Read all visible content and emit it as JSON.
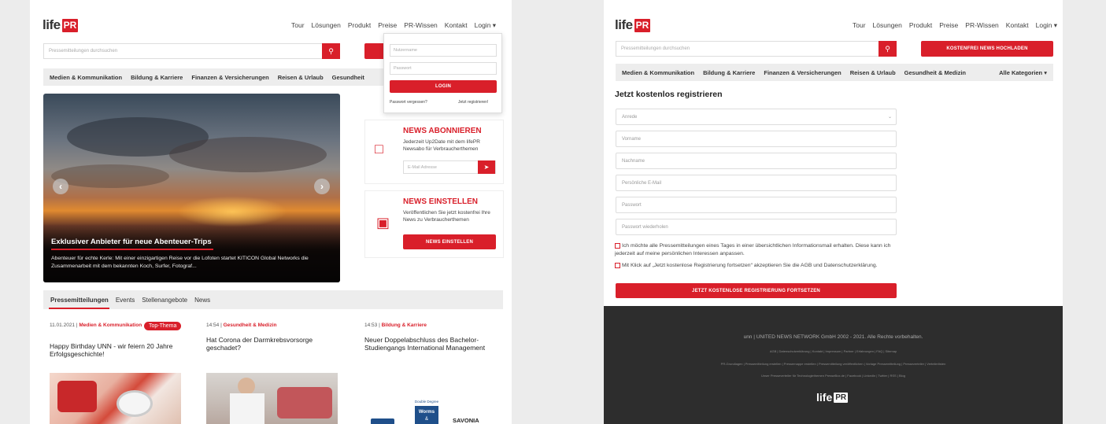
{
  "brand": {
    "logo_text": "life",
    "logo_badge": "PR",
    "accent": "#d91f2a"
  },
  "topnav": [
    "Tour",
    "Lösungen",
    "Produkt",
    "Preise",
    "PR-Wissen",
    "Kontakt",
    "Login ▾"
  ],
  "search": {
    "placeholder": "Pressemitteilungen durchsuchen"
  },
  "login_dropdown": {
    "user_placeholder": "Nutzername",
    "pass_placeholder": "Passwort",
    "login_btn": "LOGIN",
    "forgot": "Passwort vergessen?",
    "register": "Jetzt registrieren!"
  },
  "categories_left": [
    "Medien & Kommunikation",
    "Bildung & Karriere",
    "Finanzen & Versicherungen",
    "Reisen & Urlaub",
    "Gesundheit"
  ],
  "hero": {
    "title": "Exklusiver Anbieter für neue Abenteuer-Trips",
    "desc": "Abenteuer für echte Kerle: Mit einer einzigartigen Reise vor die Lofoten startet KITICON Global Networks die Zusammenarbeit mit dem bekannten Koch, Surfer, Fotograf..."
  },
  "sub_card": {
    "title": "NEWS ABONNIEREN",
    "text": "Jederzeit Up2Date mit dem lifePR Newsabo für Verbraucherthemen",
    "email_placeholder": "E-Mail Adresse"
  },
  "post_card": {
    "title": "NEWS EINSTELLEN",
    "text": "Veröffentlichen Sie jetzt kostenfrei Ihre News zu Verbraucherthemen",
    "btn": "NEWS EINSTELLEN"
  },
  "tabs": [
    "Pressemitteilungen",
    "Events",
    "Stellenangebote",
    "News"
  ],
  "news": [
    {
      "date": "11.01.2021 |",
      "cat": "Medien & Kommunikation",
      "tag": "Top-Thema",
      "headline": "Happy Birthday UNN - wir feiern 20 Jahre Erfolgsgeschichte!"
    },
    {
      "date": "14:54 |",
      "cat": "Gesundheit & Medizin",
      "tag": "",
      "headline": "Hat Corona der Darmkrebsvorsorge geschadet?"
    },
    {
      "date": "14:53 |",
      "cat": "Bildung & Karriere",
      "tag": "",
      "headline": "Neuer Doppelabschluss des Bachelor-Studiengangs International Management"
    }
  ],
  "news3_img": {
    "badge_top": "Double Degree",
    "badge_mid": "Worms",
    "badge_amp": "&",
    "partner": "SAVONIA"
  },
  "right": {
    "upload_btn": "KOSTENFREI NEWS HOCHLADEN",
    "categories": [
      "Medien & Kommunikation",
      "Bildung & Karriere",
      "Finanzen & Versicherungen",
      "Reisen & Urlaub",
      "Gesundheit & Medizin"
    ],
    "all_categories": "Alle Kategorien ▾",
    "form_title": "Jetzt kostenlos registrieren",
    "fields": [
      "Anrede",
      "Vorname",
      "Nachname",
      "Persönliche E-Mail",
      "Passwort",
      "Passwort wiederholen"
    ],
    "check1": "Ich möchte alle Pressemitteilungen eines Tages in einer übersichtlichen Informationsmail erhalten. Diese kann ich jederzeit auf meine persönlichen Interessen anpassen.",
    "check2": "Mit Klick auf „Jetzt kostenlose Registrierung fortsetzen“ akzeptieren Sie die AGB und Datenschutzerklärung.",
    "submit": "JETZT KOSTENLOSE REGISTRIERUNG FORTSETZEN"
  },
  "footer": {
    "copy": "unn | UNITED NEWS NETWORK GmbH 2002 - 2021. Alle Rechte vorbehalten.",
    "links1": "AGB  |  Datenschutzerklärung  |  Kontakt  |  Impressum  |  Partner  |  Erfahrungen  |  FAQ  |  Sitemap",
    "links2": "PR-Grundlagen  |  Pressemitteilung erstellen  |  Pressemappe erstellen  |  Pressemitteilung veröffentlichen  |  Vorlage Pressemitteilung  |  Presseverteiler  |  Verteilerlisten",
    "links3": "Unser Presseverteiler für Technologiethemen PresseBox.de  |  Facebook  |  LinkedIn  |  Twitter  |  RSS  |  Blog"
  }
}
